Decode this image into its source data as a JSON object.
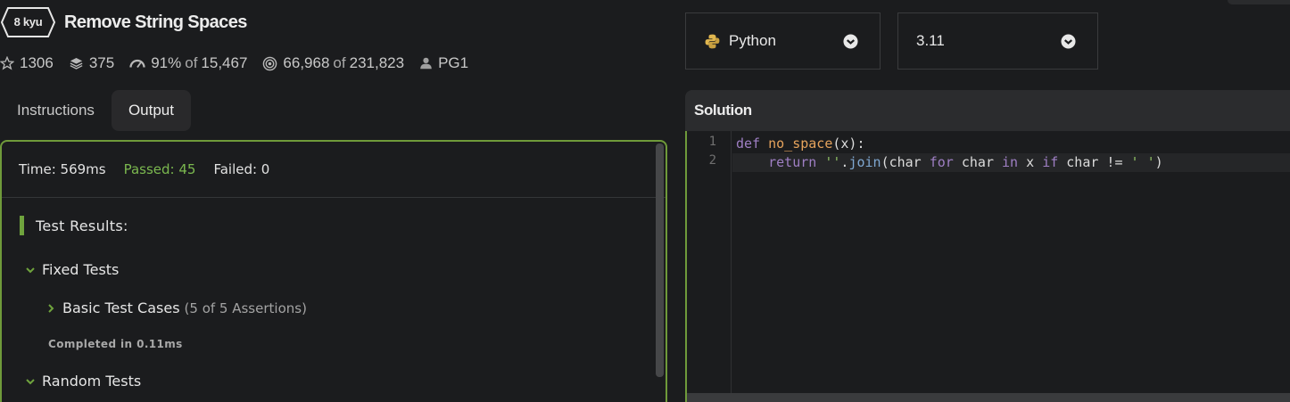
{
  "kata": {
    "rank": "8 kyu",
    "title": "Remove String Spaces",
    "stats": {
      "stars": "1306",
      "collections": "375",
      "satisfaction_percent": "91%",
      "of_word": "of",
      "satisfaction_votes": "15,467",
      "completed": "66,968",
      "attempted": "231,823",
      "author": "PG1"
    }
  },
  "tabs": [
    {
      "label": "Instructions",
      "active": false
    },
    {
      "label": "Output",
      "active": true
    }
  ],
  "output": {
    "time": "Time: 569ms",
    "passed": "Passed: 45",
    "failed": "Failed: 0",
    "results_title": "Test Results:",
    "groups": {
      "fixed": "Fixed Tests",
      "basic": "Basic Test Cases",
      "basic_assertions": "(5 of 5 Assertions)",
      "completed_in": "Completed in 0.11ms",
      "random": "Random Tests"
    }
  },
  "language": {
    "selected": "Python"
  },
  "version": {
    "selected": "3.11"
  },
  "solution": {
    "title": "Solution",
    "line_numbers": [
      "1",
      "2"
    ]
  },
  "colors": {
    "accent_green": "#6f9a3a",
    "passed_green": "#7bb84f",
    "keyword": "#9f7fc4",
    "function": "#e6a35c",
    "string": "#8fbf63"
  },
  "icons": [
    "star-icon",
    "layers-icon",
    "gauge-icon",
    "target-icon",
    "user-icon",
    "chevron-down-icon",
    "chevron-right-icon",
    "python-icon",
    "chevron-circle-down-icon"
  ]
}
